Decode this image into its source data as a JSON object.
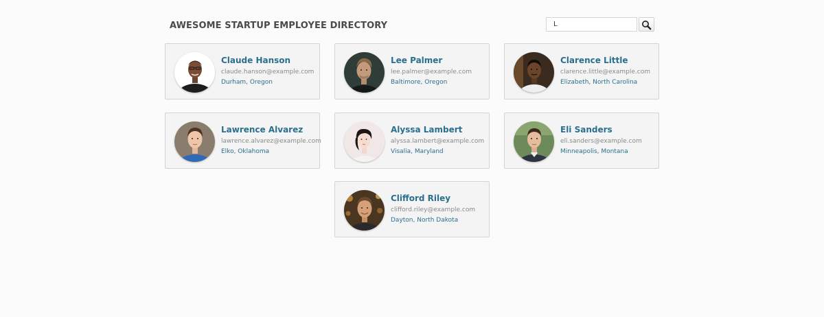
{
  "header": {
    "title": "AWESOME STARTUP EMPLOYEE DIRECTORY"
  },
  "search": {
    "value": "L",
    "button_icon": "magnifier-icon"
  },
  "colors": {
    "name": "#2a6f8e",
    "email": "#8a8a8a",
    "card_bg": "#f4f4f4",
    "card_border": "#d3d3d3",
    "page_bg": "#fbfbfb"
  },
  "employees": [
    {
      "name": "Claude Hanson",
      "email": "claude.hanson@example.com",
      "location": "Durham, Oregon"
    },
    {
      "name": "Lee Palmer",
      "email": "lee.palmer@example.com",
      "location": "Baltimore, Oregon"
    },
    {
      "name": "Clarence Little",
      "email": "clarence.little@example.com",
      "location": "Elizabeth, North Carolina"
    },
    {
      "name": "Lawrence Alvarez",
      "email": "lawrence.alvarez@example.com",
      "location": "Elko, Oklahoma"
    },
    {
      "name": "Alyssa Lambert",
      "email": "alyssa.lambert@example.com",
      "location": "Visalia, Maryland"
    },
    {
      "name": "Eli Sanders",
      "email": "eli.sanders@example.com",
      "location": "Minneapolis, Montana"
    },
    {
      "name": "Clifford Riley",
      "email": "clifford.riley@example.com",
      "location": "Dayton, North Dakota"
    }
  ]
}
